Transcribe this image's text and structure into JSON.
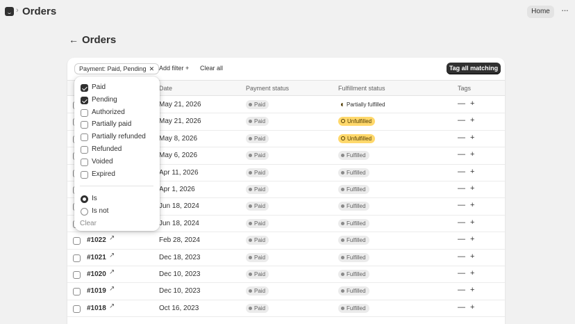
{
  "topbar": {
    "app_icon": "app-window-icon",
    "separator": "›",
    "title": "Orders",
    "home_label": "Home",
    "more_label": "···"
  },
  "page": {
    "back_icon": "←",
    "title": "Orders"
  },
  "filters": {
    "chip_label": "Payment: Paid, Pending",
    "chip_remove": "✕",
    "add_filter_label": "Add filter +",
    "clear_all_label": "Clear all",
    "tag_all_label": "Tag all matching"
  },
  "table": {
    "headers": {
      "date": "Date",
      "payment": "Payment status",
      "fulfillment": "Fulfillment status",
      "tags": "Tags"
    },
    "rows": [
      {
        "order": "",
        "date": "May 21, 2026",
        "payment": "Paid",
        "fulfillment": "Partially fulfilled",
        "fulfillment_kind": "partial"
      },
      {
        "order": "",
        "date": "May 21, 2026",
        "payment": "Paid",
        "fulfillment": "Unfulfilled",
        "fulfillment_kind": "warn"
      },
      {
        "order": "",
        "date": "May 8, 2026",
        "payment": "Paid",
        "fulfillment": "Unfulfilled",
        "fulfillment_kind": "warn"
      },
      {
        "order": "",
        "date": "May 6, 2026",
        "payment": "Paid",
        "fulfillment": "Fulfilled",
        "fulfillment_kind": "done"
      },
      {
        "order": "",
        "date": "Apr 11, 2026",
        "payment": "Paid",
        "fulfillment": "Fulfilled",
        "fulfillment_kind": "done"
      },
      {
        "order": "",
        "date": "Apr 1, 2026",
        "payment": "Paid",
        "fulfillment": "Fulfilled",
        "fulfillment_kind": "done"
      },
      {
        "order": "",
        "date": "Jun 18, 2024",
        "payment": "Paid",
        "fulfillment": "Fulfilled",
        "fulfillment_kind": "done"
      },
      {
        "order": "",
        "date": "Jun 18, 2024",
        "payment": "Paid",
        "fulfillment": "Fulfilled",
        "fulfillment_kind": "done"
      },
      {
        "order": "#1022",
        "date": "Feb 28, 2024",
        "payment": "Paid",
        "fulfillment": "Fulfilled",
        "fulfillment_kind": "done"
      },
      {
        "order": "#1021",
        "date": "Dec 18, 2023",
        "payment": "Paid",
        "fulfillment": "Fulfilled",
        "fulfillment_kind": "done"
      },
      {
        "order": "#1020",
        "date": "Dec 10, 2023",
        "payment": "Paid",
        "fulfillment": "Fulfilled",
        "fulfillment_kind": "done"
      },
      {
        "order": "#1019",
        "date": "Dec 10, 2023",
        "payment": "Paid",
        "fulfillment": "Fulfilled",
        "fulfillment_kind": "done"
      },
      {
        "order": "#1018",
        "date": "Oct 16, 2023",
        "payment": "Paid",
        "fulfillment": "Fulfilled",
        "fulfillment_kind": "done"
      }
    ],
    "tags_controls": "— +"
  },
  "popover": {
    "options": [
      {
        "label": "Paid",
        "checked": true
      },
      {
        "label": "Pending",
        "checked": true
      },
      {
        "label": "Authorized",
        "checked": false
      },
      {
        "label": "Partially paid",
        "checked": false
      },
      {
        "label": "Partially refunded",
        "checked": false
      },
      {
        "label": "Refunded",
        "checked": false
      },
      {
        "label": "Voided",
        "checked": false
      },
      {
        "label": "Expired",
        "checked": false
      }
    ],
    "match": [
      {
        "label": "Is",
        "selected": true
      },
      {
        "label": "Is not",
        "selected": false
      }
    ],
    "clear_label": "Clear"
  }
}
